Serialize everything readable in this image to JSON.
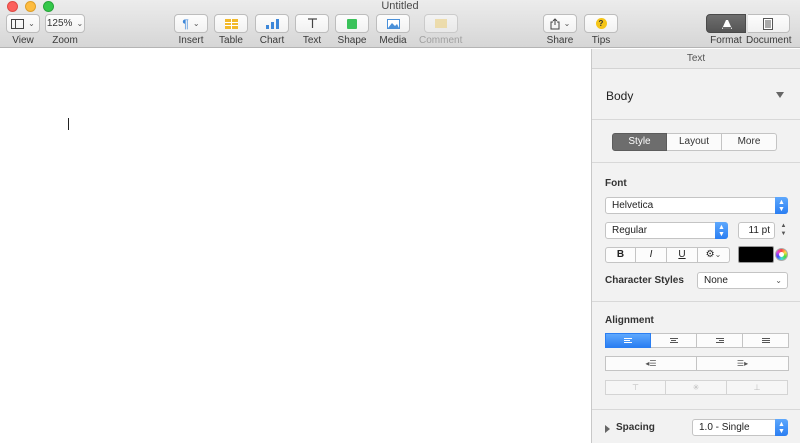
{
  "window": {
    "title": "Untitled"
  },
  "toolbar": {
    "view": {
      "label": "View"
    },
    "zoom": {
      "label": "Zoom",
      "value": "125%"
    },
    "insert": {
      "label": "Insert"
    },
    "table": {
      "label": "Table"
    },
    "chart": {
      "label": "Chart"
    },
    "text": {
      "label": "Text"
    },
    "shape": {
      "label": "Shape"
    },
    "media": {
      "label": "Media"
    },
    "comment": {
      "label": "Comment"
    },
    "share": {
      "label": "Share"
    },
    "tips": {
      "label": "Tips"
    },
    "format": {
      "label": "Format"
    },
    "document": {
      "label": "Document"
    }
  },
  "inspector": {
    "header": "Text",
    "paragraph_style": "Body",
    "tabs": [
      "Style",
      "Layout",
      "More"
    ],
    "active_tab": "Style",
    "font_section": "Font",
    "font_family": "Helvetica",
    "font_style": "Regular",
    "font_size": "11 pt",
    "format_buttons": [
      "B",
      "I",
      "U"
    ],
    "text_color": "#000000",
    "character_styles_label": "Character Styles",
    "character_styles_value": "None",
    "alignment_section": "Alignment",
    "spacing_label": "Spacing",
    "spacing_value": "1.0 - Single"
  },
  "colors": {
    "accent": "#2a7ef2",
    "chart_bars": "#3d87d9",
    "table_icon": "#f2b92b",
    "shape_icon": "#3ac25a",
    "media_icon": "#4a90d9",
    "tips_icon": "#f5c518"
  }
}
